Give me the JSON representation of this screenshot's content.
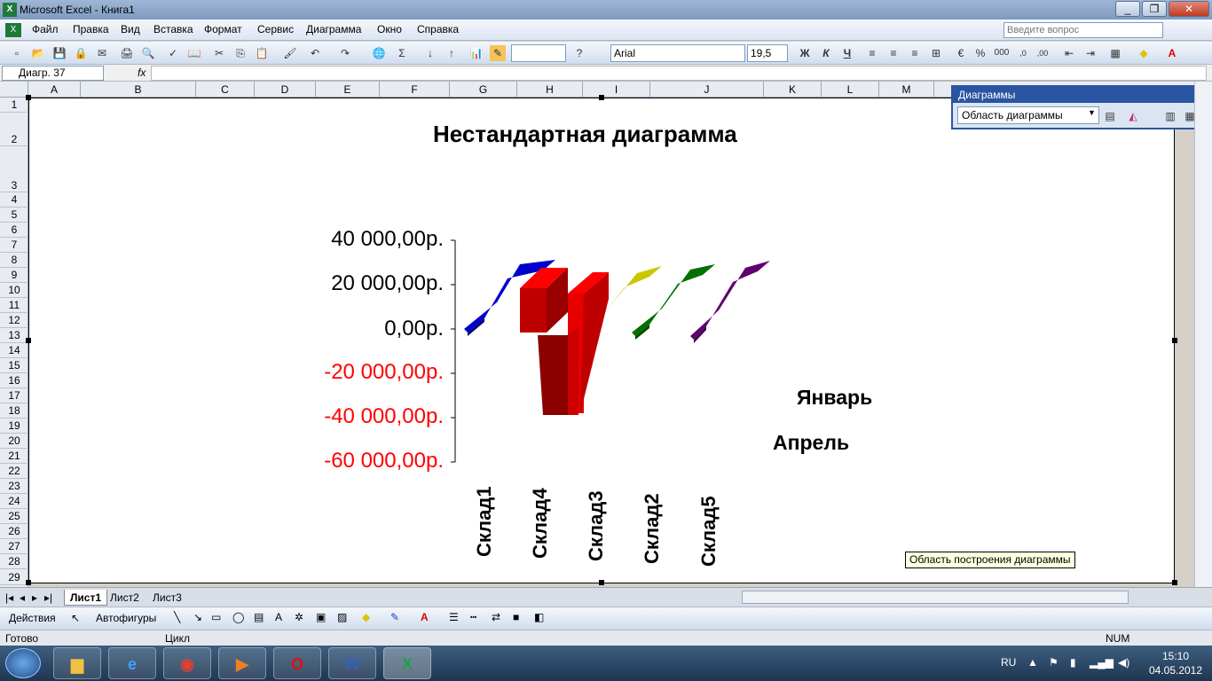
{
  "window": {
    "title": "Microsoft Excel - Книга1",
    "min": "_",
    "restore": "❐",
    "close": "✕"
  },
  "menu": [
    "Файл",
    "Правка",
    "Вид",
    "Вставка",
    "Формат",
    "Сервис",
    "Диаграмма",
    "Окно",
    "Справка"
  ],
  "help_search": {
    "placeholder": "Введите вопрос"
  },
  "toolbar": {
    "font_name": "Arial",
    "font_size": "19,5",
    "bold": "Ж",
    "italic": "К",
    "underline": "Ч"
  },
  "formula_bar": {
    "name_box": "Диагр. 37",
    "fx": "fx"
  },
  "columns": [
    "A",
    "B",
    "C",
    "D",
    "E",
    "F",
    "G",
    "H",
    "I",
    "J",
    "K",
    "L",
    "M"
  ],
  "rows": [
    "1",
    "2",
    "3",
    "4",
    "5",
    "6",
    "7",
    "8",
    "9",
    "10",
    "11",
    "12",
    "13",
    "14",
    "15",
    "16",
    "17",
    "18",
    "19",
    "20",
    "21",
    "22",
    "23",
    "24",
    "25",
    "26",
    "27",
    "28",
    "29"
  ],
  "chart_toolbar": {
    "title": "Диаграммы",
    "selected_element": "Область диаграммы"
  },
  "chart_data": {
    "type": "bar",
    "title": "Нестандартная диаграмма",
    "categories": [
      "Склад1",
      "Склад4",
      "Склад3",
      "Склад2",
      "Склад5"
    ],
    "series": [
      {
        "name": "Январь",
        "values": [
          0,
          20000,
          0,
          0,
          0
        ]
      },
      {
        "name": "Апрель",
        "values": [
          0,
          -38000,
          0,
          0,
          0
        ]
      }
    ],
    "series_colors": [
      "#0000cc",
      "#ff0000",
      "#c8c800",
      "#007000",
      "#600070"
    ],
    "y_ticks": [
      "40 000,00р.",
      "20 000,00р.",
      "0,00р.",
      "-20 000,00р.",
      "-40 000,00р.",
      "-60 000,00р."
    ],
    "ylim": [
      -60000,
      40000
    ],
    "negative_tick_color": "#ff0000",
    "legend_position": "right"
  },
  "tooltip": "Область построения диаграммы",
  "sheet_tabs": [
    "Лист1",
    "Лист2",
    "Лист3"
  ],
  "drawing": {
    "actions": "Действия",
    "autoshapes": "Автофигуры"
  },
  "status": {
    "ready": "Готово",
    "mode": "Цикл",
    "num": "NUM"
  },
  "taskbar": {
    "lang": "RU",
    "time": "15:10",
    "date": "04.05.2012"
  }
}
